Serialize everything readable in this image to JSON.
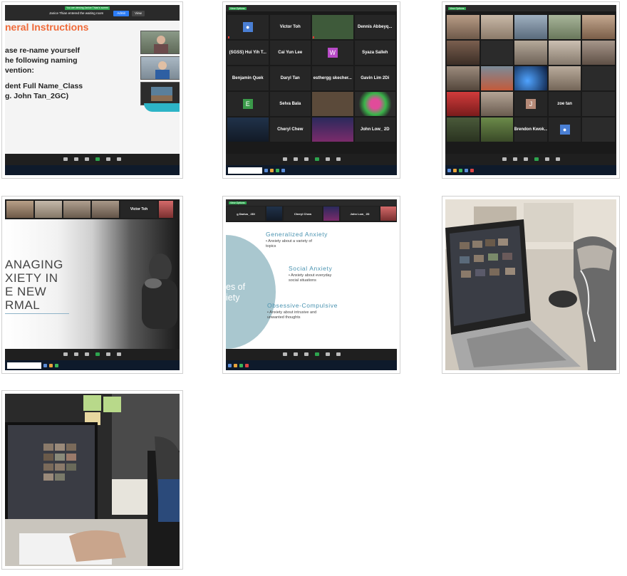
{
  "screenshot1": {
    "notice": "You are viewing Janice Thian's screen",
    "waiting_room_text": "Janice Thian entered the waiting room",
    "admit_label": "Admit",
    "view_label": "View",
    "slide_heading": "neral Instructions",
    "slide_lines": [
      "ase re-name yourself",
      "he following naming",
      "vention:",
      "dent Full Name_Class",
      "g. John Tan_2GC)"
    ]
  },
  "screenshot2": {
    "view_options": "View Options",
    "tiles": [
      "",
      "Victor Toh",
      "",
      "Dennis Abbeyq...",
      "(SGSS) Hui Yih T...",
      "Cai Yun Lee",
      "W",
      "Syaza Salleh",
      "Benjamin Quek",
      "Daryl Tan",
      "esthergg skecher...",
      "Gavin Lim 2Di",
      "E",
      "Selva Bala",
      "",
      "",
      "",
      "Cheryl Chew",
      "",
      "John Low_ 2D"
    ],
    "toolbar": [
      "Security",
      "Participants",
      "Chat",
      "Share Screen",
      "Pause/Stop Recording",
      "Reactions"
    ]
  },
  "screenshot3": {
    "view_options": "View Options",
    "tiles_named": [
      "J",
      "zoe tan",
      "Brendon Kwok..."
    ],
    "toolbar": [
      "Security",
      "Participants",
      "Chat",
      "Share Screen",
      "Pause/Stop Recording",
      "Reactions"
    ]
  },
  "screenshot4": {
    "strip_name": "Victor Toh",
    "slide_title": [
      "ANAGING",
      "XIETY IN",
      "E NEW",
      "RMAL"
    ],
    "toolbar": [
      "Security",
      "Participants",
      "Chat",
      "Share Screen",
      "Pause/Stop Recording",
      "Reactions"
    ]
  },
  "screenshot5": {
    "view_options": "View Options",
    "strip_names": [
      "g Darius_ 2DI",
      "",
      "Cheryl Chew",
      "",
      "John Low_ 2D",
      ""
    ],
    "side_title": [
      "es of",
      "iety"
    ],
    "sections": [
      {
        "heading": "Generalized Anxiety",
        "bullet": [
          "• Anxiety about a variety of",
          "   topics"
        ]
      },
      {
        "heading": "Social Anxiety",
        "bullet": [
          "• Anxiety about everyday",
          "   social situations"
        ]
      },
      {
        "heading": "Obsessive-Compulsive",
        "bullet": [
          "• Anxiety about intrusive and",
          "   unwanted thoughts"
        ]
      }
    ],
    "toolbar": [
      "Security",
      "Participants",
      "Chat",
      "Share Screen",
      "Pause/Stop Recording",
      "Reactions"
    ]
  },
  "colors": {
    "accent_orange": "#f06b3a",
    "zoom_green": "#2da44e",
    "slide_blue": "#4a93b0",
    "circle_blue": "#a9c7cf"
  }
}
